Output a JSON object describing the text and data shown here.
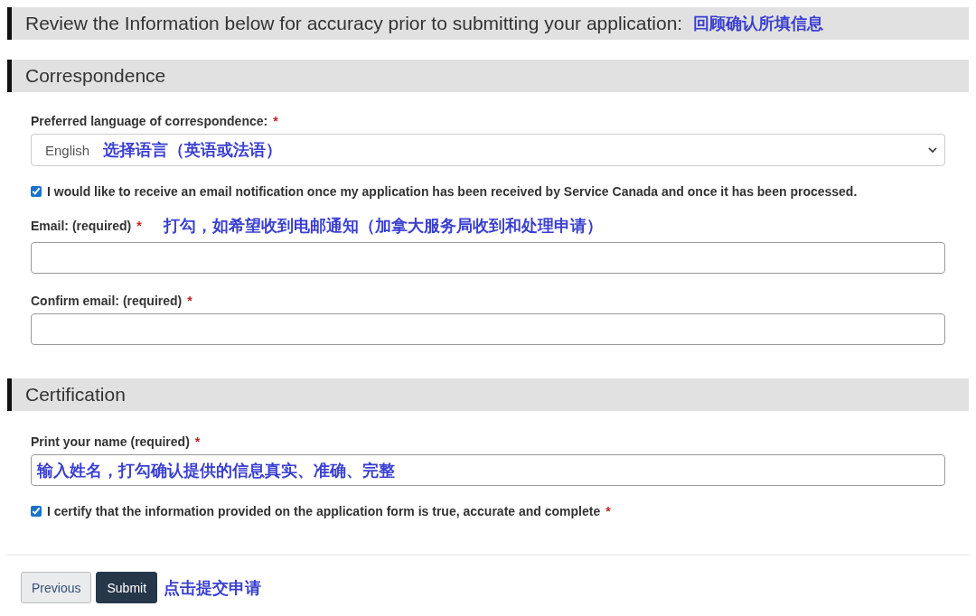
{
  "review_heading": {
    "text": "Review the Information below for accuracy prior to submitting your application:",
    "annotation": "回顾确认所填信息"
  },
  "correspondence": {
    "title": "Correspondence",
    "language": {
      "label": "Preferred language of correspondence:",
      "required_mark": "*",
      "value": "English",
      "annotation": "选择语言（英语或法语）"
    },
    "notify": {
      "label": "I would like to receive an email notification once my application has been received by Service Canada and once it has been processed.",
      "checked": true
    },
    "email": {
      "label": "Email: (required)",
      "required_mark": "*",
      "annotation": "打勾，如希望收到电邮通知（加拿大服务局收到和处理申请）"
    },
    "confirm_email": {
      "label": "Confirm email: (required)",
      "required_mark": "*"
    }
  },
  "certification": {
    "title": "Certification",
    "name": {
      "label": "Print your name (required)",
      "required_mark": "*",
      "annotation": "输入姓名，打勾确认提供的信息真实、准确、完整"
    },
    "certify": {
      "label": "I certify that the information provided on the application form is true, accurate and complete",
      "required_mark": "*",
      "checked": true
    }
  },
  "buttons": [
    {
      "label": "Previous",
      "kind": "secondary"
    },
    {
      "label": "Submit",
      "kind": "primary"
    }
  ],
  "submit_annotation": "点击提交申请"
}
